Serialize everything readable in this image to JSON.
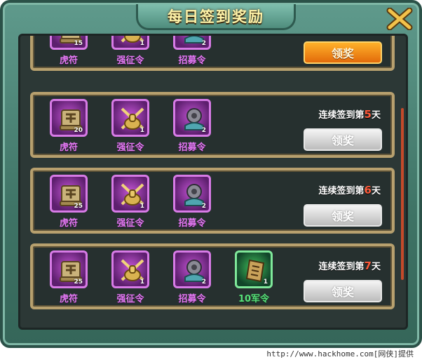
{
  "title": "每日签到奖励",
  "rows": [
    {
      "items": [
        {
          "name": "虎符",
          "count": "15",
          "icon": "tiger-tally-icon",
          "rarity": "purple"
        },
        {
          "name": "强征令",
          "count": "1",
          "icon": "crossed-swords-helmet-icon",
          "rarity": "purple"
        },
        {
          "name": "招募令",
          "count": "2",
          "icon": "recruit-token-icon",
          "rarity": "purple"
        }
      ],
      "claim_label": "领奖",
      "claim_state": "active"
    },
    {
      "day_prefix": "连续签到第",
      "day": "5",
      "day_suffix": "天",
      "items": [
        {
          "name": "虎符",
          "count": "20",
          "icon": "tiger-tally-icon",
          "rarity": "purple"
        },
        {
          "name": "强征令",
          "count": "1",
          "icon": "crossed-swords-helmet-icon",
          "rarity": "purple"
        },
        {
          "name": "招募令",
          "count": "2",
          "icon": "recruit-token-icon",
          "rarity": "purple"
        }
      ],
      "claim_label": "领奖",
      "claim_state": "disabled"
    },
    {
      "day_prefix": "连续签到第",
      "day": "6",
      "day_suffix": "天",
      "items": [
        {
          "name": "虎符",
          "count": "25",
          "icon": "tiger-tally-icon",
          "rarity": "purple"
        },
        {
          "name": "强征令",
          "count": "1",
          "icon": "crossed-swords-helmet-icon",
          "rarity": "purple"
        },
        {
          "name": "招募令",
          "count": "2",
          "icon": "recruit-token-icon",
          "rarity": "purple"
        }
      ],
      "claim_label": "领奖",
      "claim_state": "disabled"
    },
    {
      "day_prefix": "连续签到第",
      "day": "7",
      "day_suffix": "天",
      "items": [
        {
          "name": "虎符",
          "count": "25",
          "icon": "tiger-tally-icon",
          "rarity": "purple"
        },
        {
          "name": "强征令",
          "count": "1",
          "icon": "crossed-swords-helmet-icon",
          "rarity": "purple"
        },
        {
          "name": "招募令",
          "count": "2",
          "icon": "recruit-token-icon",
          "rarity": "purple"
        },
        {
          "name": "10军令",
          "count": "1",
          "icon": "military-order-icon",
          "rarity": "green"
        }
      ],
      "claim_label": "领奖",
      "claim_state": "disabled"
    }
  ],
  "watermark": "http://www.hackhome.com[网侠]提供",
  "colors": {
    "accent_orange": "#e26a0a",
    "day_number": "#ff5a3a",
    "purple_name": "#e27bf2",
    "green_name": "#58e07a"
  }
}
